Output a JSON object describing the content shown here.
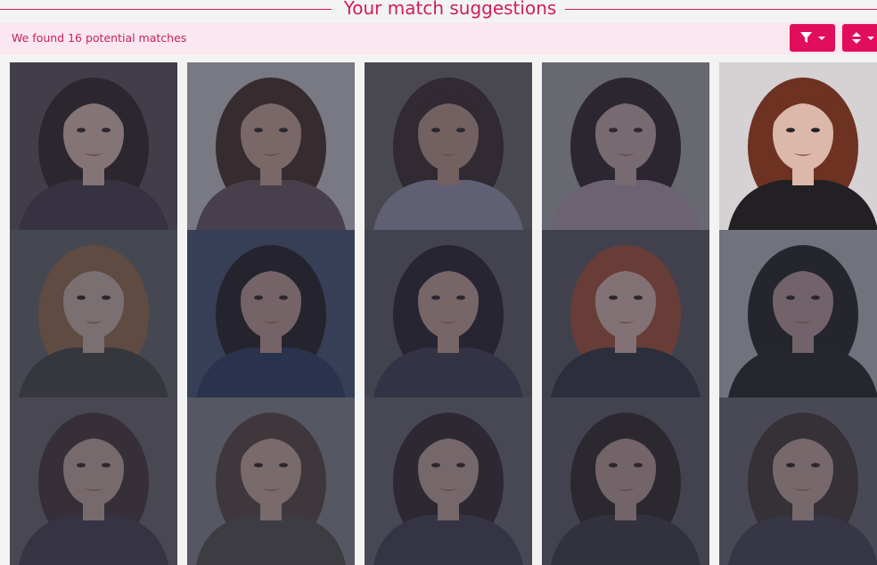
{
  "header": {
    "title": "Your match suggestions"
  },
  "results": {
    "summary": "We found 16 potential matches"
  },
  "toolbar": {
    "filter_icon": "filter-icon",
    "sort_icon": "sort-icon",
    "accent_color": "#e20d5c"
  },
  "photos": [
    {
      "name": "match-photo-1",
      "bg": "#4d4850",
      "hair": "#2b2226",
      "skin": "#b89e98",
      "top": "#3a3543",
      "state": "dimmed"
    },
    {
      "name": "match-photo-2",
      "bg": "#a7a7ad",
      "hair": "#3b2b28",
      "skin": "#a98a80",
      "top": "#584a55",
      "state": "dimmed"
    },
    {
      "name": "match-photo-3",
      "bg": "#59575b",
      "hair": "#33272a",
      "skin": "#9d7e77",
      "top": "#7d7f95",
      "state": "dimmed"
    },
    {
      "name": "match-photo-4",
      "bg": "#8c8b8f",
      "hair": "#2a2128",
      "skin": "#a48f8e",
      "top": "#938290",
      "state": "dimmed"
    },
    {
      "name": "match-photo-5",
      "bg": "#d6d1d2",
      "hair": "#6d3222",
      "skin": "#dcb8aa",
      "top": "#222024",
      "state": "highlighted"
    },
    {
      "name": "match-photo-6",
      "bg": "#55575c",
      "hair": "#7d5d45",
      "skin": "#a99690",
      "top": "#3b3d3d",
      "state": "dimmed"
    },
    {
      "name": "match-photo-7",
      "bg": "#3d4a65",
      "hair": "#1f1d24",
      "skin": "#9e8480",
      "top": "#273558",
      "state": "dimmed"
    },
    {
      "name": "match-photo-8",
      "bg": "#505059",
      "hair": "#24202a",
      "skin": "#a38882",
      "top": "#363649",
      "state": "dimmed"
    },
    {
      "name": "match-photo-9",
      "bg": "#4c4c57",
      "hair": "#8d4633",
      "skin": "#b69b96",
      "top": "#2d2e3b",
      "state": "dimmed"
    },
    {
      "name": "match-photo-10",
      "bg": "#9a9ba2",
      "hair": "#202025",
      "skin": "#9a8483",
      "top": "#212126",
      "state": "dimmed"
    },
    {
      "name": "match-photo-11",
      "bg": "#58565e",
      "hair": "#3a2f32",
      "skin": "#a38e8a",
      "top": "#3b3846",
      "state": "dimmed"
    },
    {
      "name": "match-photo-12",
      "bg": "#6d7078",
      "hair": "#4a3d3a",
      "skin": "#a68f88",
      "top": "#444",
      "state": "dimmed"
    },
    {
      "name": "match-photo-13",
      "bg": "#585863",
      "hair": "#2c252a",
      "skin": "#a18985",
      "top": "#373747",
      "state": "dimmed"
    },
    {
      "name": "match-photo-14",
      "bg": "#4f505b",
      "hair": "#2a2428",
      "skin": "#9d8583",
      "top": "#34343f",
      "state": "dimmed"
    },
    {
      "name": "match-photo-15",
      "bg": "#5a5a64",
      "hair": "#3b3132",
      "skin": "#a48c86",
      "top": "#3a3a48",
      "state": "dimmed"
    }
  ]
}
